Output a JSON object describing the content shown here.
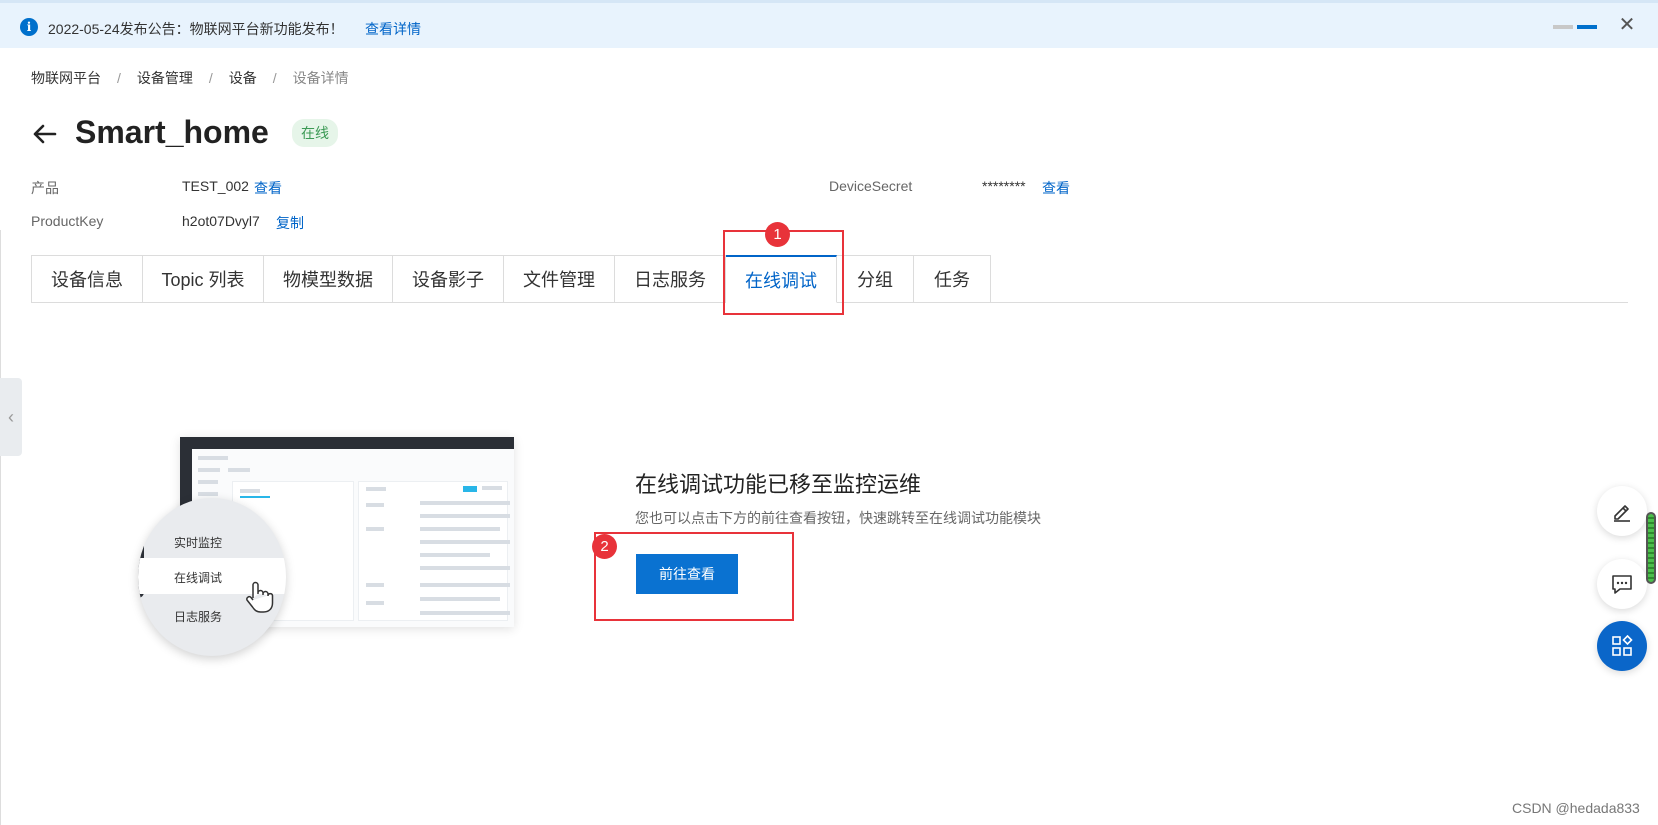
{
  "notice": {
    "text": "2022-05-24发布公告：物联网平台新功能发布！",
    "link": "查看详情"
  },
  "breadcrumb": {
    "items": [
      "物联网平台",
      "设备管理",
      "设备",
      "设备详情"
    ],
    "separator": "/"
  },
  "device": {
    "name": "Smart_home",
    "status": "在线"
  },
  "info": {
    "product_label": "产品",
    "product_value": "TEST_002",
    "product_link": "查看",
    "productkey_label": "ProductKey",
    "productkey_value": "h2ot07Dvyl7",
    "productkey_link": "复制",
    "secret_label": "DeviceSecret",
    "secret_value": "********",
    "secret_link": "查看"
  },
  "tabs": [
    {
      "label": "设备信息",
      "active": false
    },
    {
      "label": "Topic 列表",
      "active": false
    },
    {
      "label": "物模型数据",
      "active": false
    },
    {
      "label": "设备影子",
      "active": false
    },
    {
      "label": "文件管理",
      "active": false
    },
    {
      "label": "日志服务",
      "active": false
    },
    {
      "label": "在线调试",
      "active": true
    },
    {
      "label": "分组",
      "active": false
    },
    {
      "label": "任务",
      "active": false
    }
  ],
  "annotations": [
    "1",
    "2"
  ],
  "illustration": {
    "menu_items": [
      "实时监控",
      "在线调试",
      "日志服务"
    ]
  },
  "message": {
    "title": "在线调试功能已移至监控运维",
    "description": "您也可以点击下方的前往查看按钮，快速跳转至在线调试功能模块",
    "button": "前往查看"
  },
  "floating_icons": [
    "edit-icon",
    "chat-icon",
    "apps-icon"
  ],
  "colors": {
    "primary": "#0064c8",
    "annotation": "#e8333a",
    "status_green": "#3c9a55",
    "notice_bg": "#e8f3fd"
  },
  "watermark": "CSDN @hedada833"
}
